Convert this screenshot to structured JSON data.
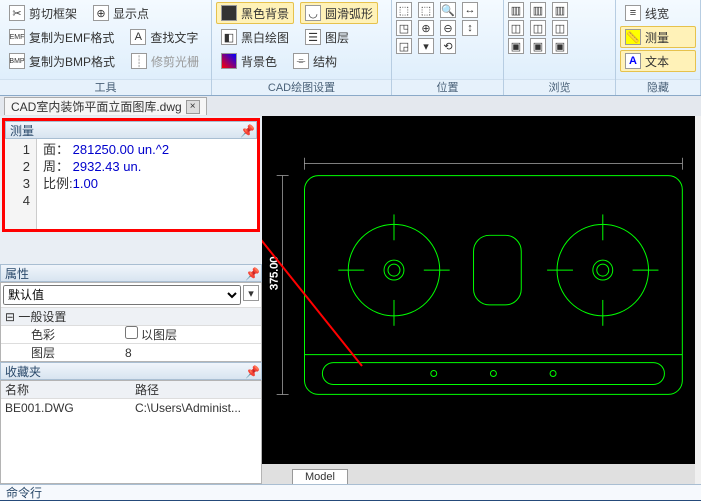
{
  "ribbon": {
    "g1": {
      "label": "工具",
      "b1": "剪切框架",
      "b2": "显示点",
      "b3": "复制为EMF格式",
      "b4": "查找文字",
      "b5": "复制为BMP格式",
      "b6": "修剪光栅"
    },
    "g2": {
      "label": "CAD绘图设置",
      "b1": "黑色背景",
      "b2": "圆滑弧形",
      "b3": "黑白绘图",
      "b4": "图层",
      "b5": "背景色",
      "b6": "结构"
    },
    "g3": {
      "label": "位置"
    },
    "g4": {
      "label": "浏览"
    },
    "g5": {
      "label": "隐藏",
      "b1": "线宽",
      "b2": "测量",
      "b3": "文本"
    }
  },
  "file": {
    "name": "CAD室内装饰平面立面图库.dwg",
    "close": "×"
  },
  "measure": {
    "title": "测量",
    "rows": [
      {
        "n": "1",
        "k": "面：",
        "v": "281250.00 un.^2"
      },
      {
        "n": "2",
        "k": "周：",
        "v": "2932.43 un."
      },
      {
        "n": "3",
        "k": "比例:",
        "v": "1.00"
      },
      {
        "n": "4",
        "k": "",
        "v": ""
      }
    ]
  },
  "props": {
    "title": "属性",
    "selected": "默认值",
    "section": "一般设置",
    "r1": {
      "k": "色彩",
      "v": "以图层"
    },
    "r2": {
      "k": "图层",
      "v": "8"
    }
  },
  "fav": {
    "title": "收藏夹",
    "h1": "名称",
    "h2": "路径",
    "c1": "BE001.DWG",
    "c2": "C:\\Users\\Administ..."
  },
  "canvas": {
    "dim": "375.00",
    "tab": "Model"
  },
  "cmd": {
    "label": "命令行"
  }
}
